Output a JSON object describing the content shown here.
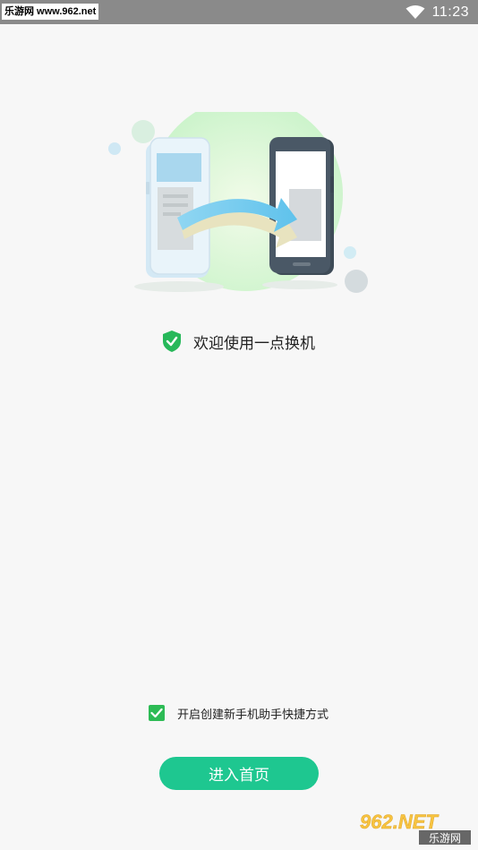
{
  "status_bar": {
    "watermark": "乐游网 www.962.net",
    "time": "11:23",
    "wifi_icon": "wifi-icon"
  },
  "hero": {
    "illustration": "phone-transfer-illustration"
  },
  "welcome": {
    "icon": "shield-check-icon",
    "text": "欢迎使用一点换机"
  },
  "shortcut": {
    "checked": true,
    "label": "开启创建新手机助手快捷方式"
  },
  "enter_button": {
    "label": "进入首页"
  },
  "watermark_bottom": {
    "brand": "962.NET",
    "subtitle": "乐游网"
  },
  "colors": {
    "accent": "#1ec790",
    "checkbox": "#2dbb55",
    "shield": "#27b85a",
    "status_bar": "#8a8a8a"
  }
}
